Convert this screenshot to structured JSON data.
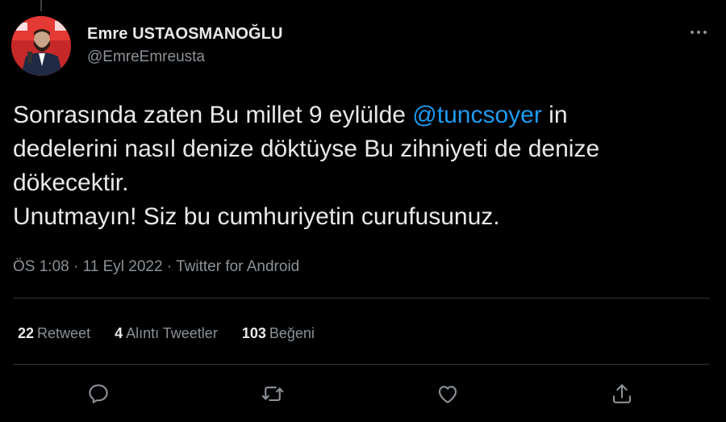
{
  "tweet": {
    "author": {
      "display_name": "Emre USTAOSMANOĞLU",
      "handle": "@EmreEmreusta"
    },
    "text": {
      "part1": "Sonrasında zaten Bu millet 9 eylülde ",
      "mention": "@tuncsoyer",
      "part2": " in\ndedelerini nasıl denize döktüyse Bu zihniyeti de denize\ndökecektir.\nUnutmayın! Siz bu cumhuriyetin curufusunuz."
    },
    "meta": {
      "time": "ÖS 1:08",
      "separator1": " · ",
      "date": "11 Eyl 2022",
      "separator2": " · ",
      "source": "Twitter for Android"
    },
    "stats": [
      {
        "count": "22",
        "label": "Retweet"
      },
      {
        "count": "4",
        "label": "Alıntı Tweetler"
      },
      {
        "count": "103",
        "label": "Beğeni"
      }
    ],
    "actions": [
      "reply-icon",
      "retweet-icon",
      "like-icon",
      "share-icon"
    ],
    "colors": {
      "background": "#000000",
      "mention": "#1d9bf0",
      "secondary_text": "#8b9197",
      "primary_text": "#e7e9ea",
      "divider": "#2f3336"
    }
  }
}
